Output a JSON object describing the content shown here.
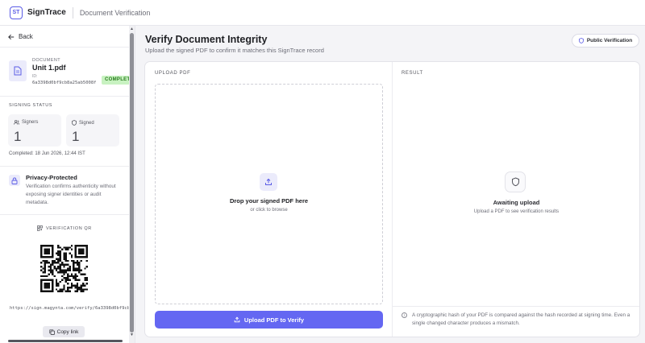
{
  "app": {
    "logo_text": "ST",
    "brand": "SignTrace",
    "breadcrumb": "Document Verification"
  },
  "sidebar": {
    "back_label": "Back",
    "document": {
      "kicker": "DOCUMENT",
      "name": "Unit 1.pdf",
      "id_label": "ID:",
      "id_value": "6a3398d0bf9cb8a25ab5008f",
      "status_badge": "COMPLETE"
    },
    "signing_status": {
      "heading": "SIGNING STATUS",
      "signers_label": "Signers",
      "signers_value": "1",
      "signed_label": "Signed",
      "signed_value": "1",
      "completed": "Completed: 18 Jun 2026, 12:44 IST"
    },
    "privacy": {
      "title": "Privacy-Protected",
      "text": "Verification confirms authenticity without exposing signer identities or audit metadata."
    },
    "qr": {
      "heading": "VERIFICATION QR",
      "url": "https://sign.magynta.com/verify/6a3398d0bf9cb8a25ab5008f",
      "copy_label": "Copy link"
    }
  },
  "main": {
    "title": "Verify Document Integrity",
    "subtitle": "Upload the signed PDF to confirm it matches this SignTrace record",
    "public_button": "Public Verification",
    "upload": {
      "heading": "UPLOAD PDF",
      "drop_title": "Drop your signed PDF here",
      "drop_sub": "or click to browse",
      "button_label": "Upload PDF to Verify"
    },
    "result": {
      "heading": "RESULT",
      "title": "Awaiting upload",
      "sub": "Upload a PDF to see verification results",
      "info": "A cryptographic hash of your PDF is compared against the hash recorded at signing time. Even a single changed character produces a mismatch."
    }
  },
  "colors": {
    "accent": "#6467f2",
    "badge_bg": "#c8f2c1",
    "badge_text": "#2a7d1f"
  }
}
